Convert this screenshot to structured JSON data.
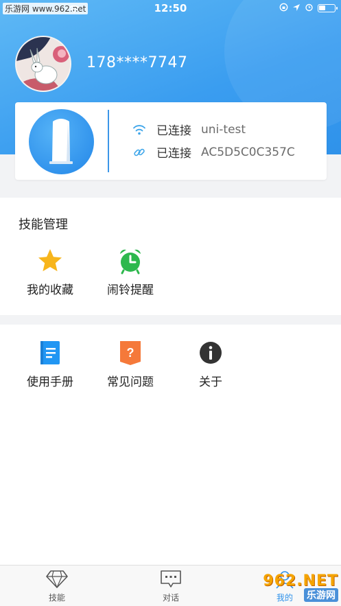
{
  "status_bar": {
    "carrier": "乐游网 www.962.net",
    "time": "12:50"
  },
  "profile": {
    "phone": "178****7747"
  },
  "device": {
    "wifi_status": "已连接",
    "wifi_name": "uni-test",
    "device_status": "已连接",
    "device_id": "AC5D5C0C357C"
  },
  "skills": {
    "title": "技能管理",
    "items": [
      {
        "label": "我的收藏",
        "icon": "star-icon",
        "color": "#f7b51c"
      },
      {
        "label": "闹铃提醒",
        "icon": "alarm-clock-icon",
        "color": "#2db84d"
      }
    ]
  },
  "more": {
    "items": [
      {
        "label": "使用手册",
        "icon": "book-icon",
        "color": "#2196f3"
      },
      {
        "label": "常见问题",
        "icon": "question-icon",
        "color": "#f5793a"
      },
      {
        "label": "关于",
        "icon": "info-icon",
        "color": "#333333"
      }
    ]
  },
  "tabbar": {
    "tabs": [
      {
        "label": "技能",
        "icon": "diamond-icon"
      },
      {
        "label": "对话",
        "icon": "chat-icon"
      },
      {
        "label": "我的",
        "icon": "user-icon",
        "active": true
      }
    ]
  },
  "watermark": {
    "top": "962.NET",
    "bottom": "乐游网"
  },
  "colors": {
    "accent": "#2f92ea",
    "header_light": "#5fb9f5"
  }
}
